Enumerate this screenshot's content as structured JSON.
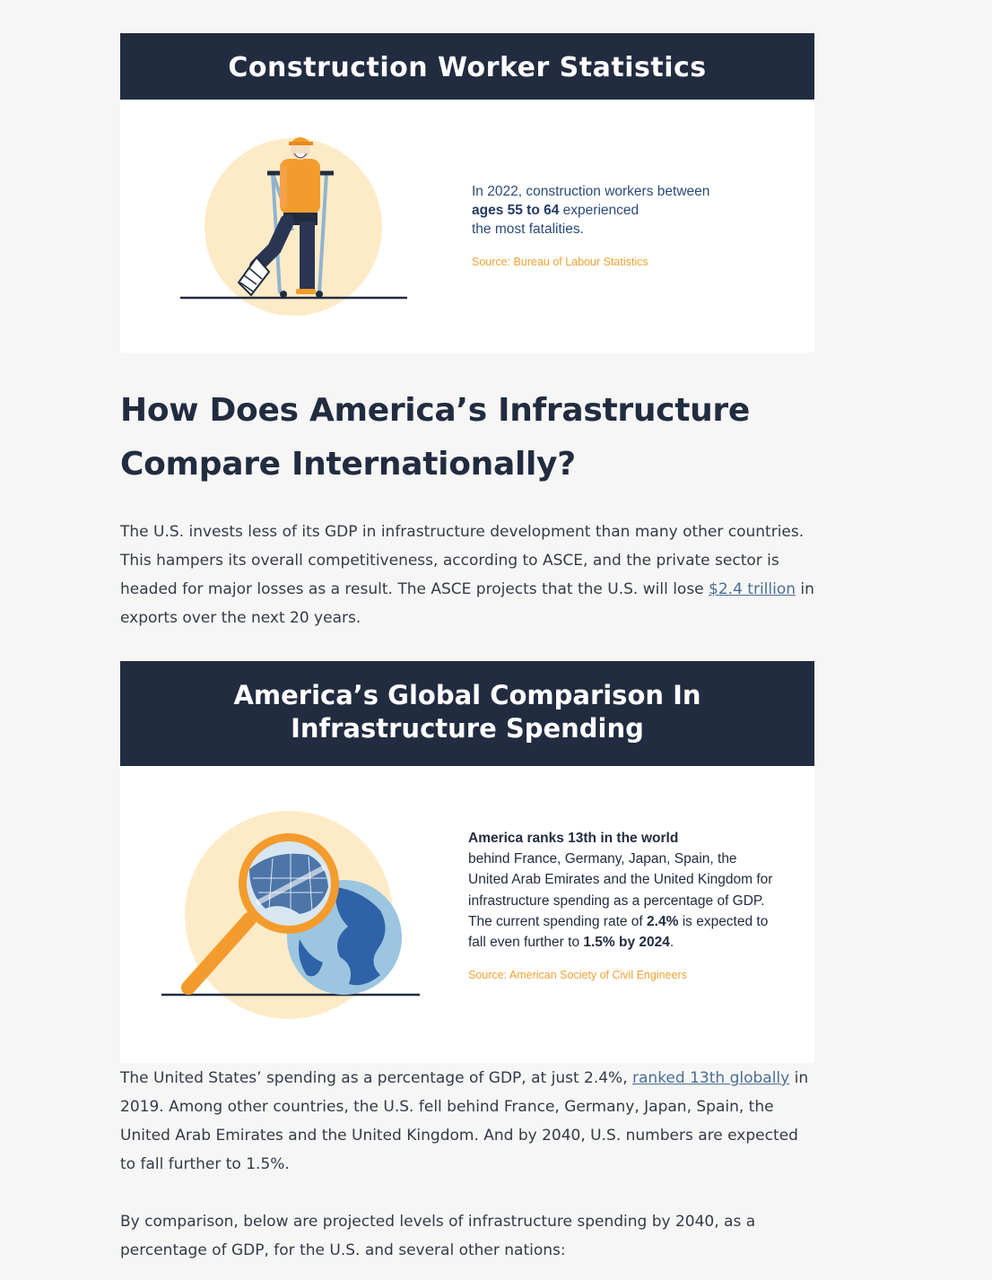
{
  "card1": {
    "title": "Construction Worker Statistics",
    "stat_prefix": "In 2022, construction workers between",
    "stat_bold": "ages 55 to 64",
    "stat_suffix": "experienced",
    "stat_line3": "the most fatalities.",
    "source": "Source: Bureau of Labour Statistics"
  },
  "heading": {
    "line1": "How Does America’s Infrastructure",
    "line2": "Compare Internationally?"
  },
  "para1": {
    "text_before_link": "The U.S. invests less of its GDP in infrastructure development than many other countries. This hampers its overall competitiveness, according to ASCE, and the private sector is headed for major losses as a result. The ASCE projects that the U.S. will lose ",
    "link": "$2.4 trillion",
    "text_after_link": " in exports over the next 20 years."
  },
  "card2": {
    "title_line1": "America’s Global Comparison In",
    "title_line2": "Infrastructure Spending",
    "stat_bold_lead": "America ranks 13th in the world",
    "stat_text1": "behind France, Germany, Japan, Spain, the United Arab Emirates and the United Kingdom for infrastructure spending as a percentage of GDP. The current spending rate of ",
    "stat_bold_rate": "2.4%",
    "stat_text2": " is expected to fall even further to ",
    "stat_bold_future": "1.5% by 2024",
    "stat_end": ".",
    "source": "Source: American Society of Civil Engineers"
  },
  "para2": {
    "text_before_link": "The United States’ spending as a percentage of GDP, at just 2.4%, ",
    "link": "ranked 13th globally",
    "text_after_link": " in 2019. Among other countries, the U.S. fell behind France, Germany, Japan, Spain, the United Arab Emirates and the United Kingdom. And by 2040, U.S. numbers are expected to fall further to 1.5%."
  },
  "para3": {
    "text": "By comparison, below are projected levels of infrastructure spending by 2040, as a percentage of GDP, for the U.S. and several other nations:"
  },
  "colors": {
    "navy": "#222c40",
    "orange": "#f0a233",
    "link": "#4a6f95",
    "peach": "#fdebc8"
  }
}
